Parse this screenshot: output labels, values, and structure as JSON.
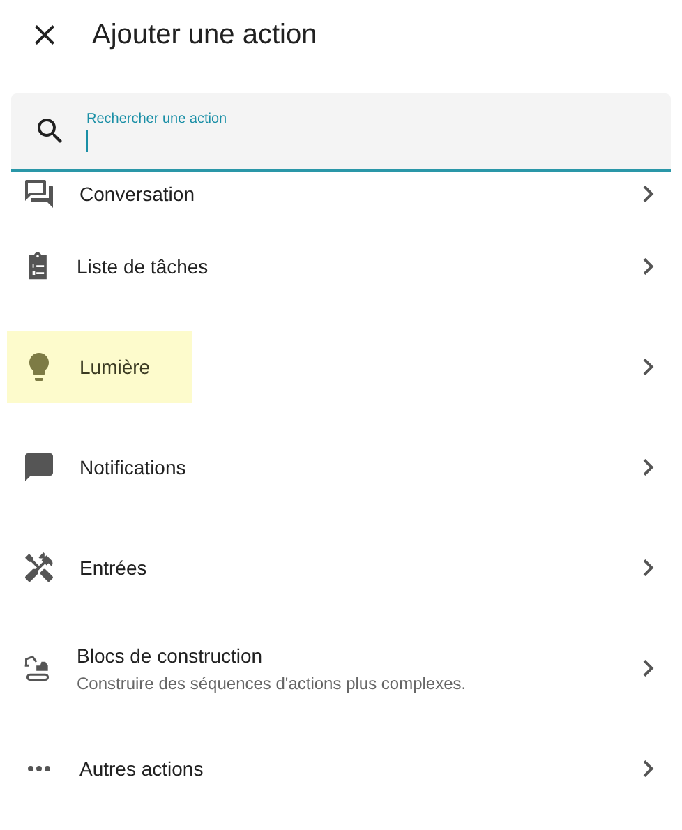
{
  "dialog": {
    "title": "Ajouter une action"
  },
  "search": {
    "label": "Rechercher une action",
    "focused": true
  },
  "items": [
    {
      "label": "Conversation",
      "highlighted": false
    },
    {
      "label": "Liste de tâches",
      "highlighted": false
    },
    {
      "label": "Lumière",
      "highlighted": true
    },
    {
      "label": "Notifications",
      "highlighted": false
    },
    {
      "label": "Entrées",
      "highlighted": false
    },
    {
      "label": "Blocs de construction",
      "description": "Construire des séquences d'actions plus complexes.",
      "highlighted": false
    },
    {
      "label": "Autres actions",
      "highlighted": false
    }
  ]
}
